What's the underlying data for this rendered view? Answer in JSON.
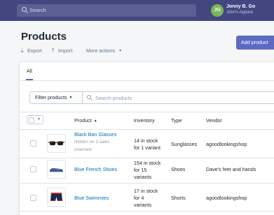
{
  "topbar": {
    "search_placeholder": "Search",
    "user_initials": "JG",
    "user_name": "Jonny B. Go",
    "store_name": "John's Appare"
  },
  "page": {
    "title": "Products",
    "export_label": "Export",
    "import_label": "Import",
    "more_actions_label": "More actions",
    "add_product_label": "Add product"
  },
  "tabs": [
    {
      "label": "All"
    }
  ],
  "filter": {
    "button_label": "Filter products",
    "search_placeholder": "Search products"
  },
  "table": {
    "columns": {
      "product": "Product",
      "inventory": "Inventory",
      "type": "Type",
      "vendor": "Vendor"
    },
    "rows": [
      {
        "product": "Black Ban Glasses",
        "note": "Hidden on 3 sales channels",
        "note_line1": "Hidden on 3 sales",
        "note_line2": "channels",
        "inventory": "14 in stock for 1 variant",
        "inventory_line1": "14 in stock",
        "inventory_line2": "for 1 variant",
        "type": "Sunglasses",
        "vendor": "agoodlookingshop"
      },
      {
        "product": "Blue French Shoes",
        "inventory": "154 in stock for 15 variants",
        "inventory_line1": "154 in stock",
        "inventory_line2": "for 15",
        "inventory_line3": "variants",
        "type": "Shoes",
        "vendor": "Dave's feet and hands"
      },
      {
        "product": "Blue Swimmies",
        "inventory": "17 in stock for 4 variants",
        "inventory_line1": "17 in stock",
        "inventory_line2": "for 4",
        "inventory_line3": "variants",
        "type": "Shorts",
        "vendor": "agoodlookingshop"
      }
    ]
  },
  "colors": {
    "topbar": "#43467f",
    "accent": "#5c6ac4",
    "link": "#006fbb",
    "avatar": "#7ab55c"
  },
  "icons": [
    "search-icon",
    "export-icon",
    "import-icon",
    "chevron-down-icon",
    "sort-up-icon"
  ]
}
